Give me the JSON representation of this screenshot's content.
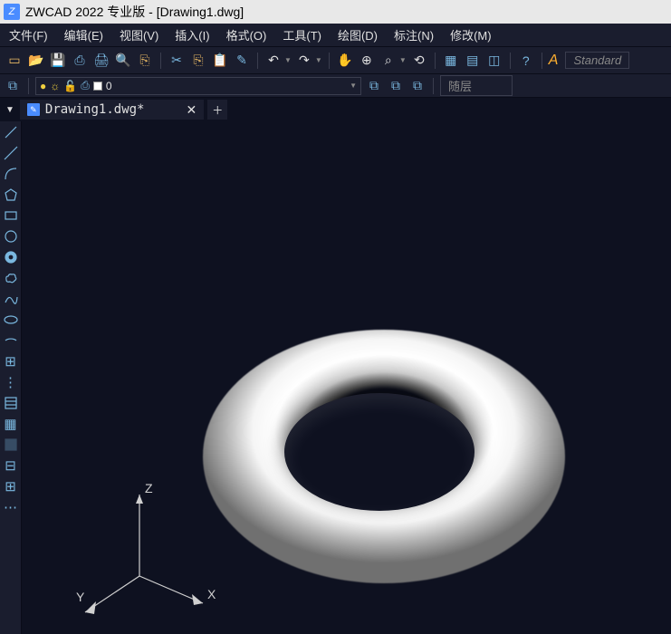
{
  "title": "ZWCAD 2022 专业版 - [Drawing1.dwg]",
  "menu": {
    "file": "文件(F)",
    "edit": "编辑(E)",
    "view": "视图(V)",
    "insert": "插入(I)",
    "format": "格式(O)",
    "tools": "工具(T)",
    "draw": "绘图(D)",
    "dim": "标注(N)",
    "modify": "修改(M)"
  },
  "style_box": "Standard",
  "layer": {
    "name": "0",
    "bylayer": "随层"
  },
  "tab": {
    "name": "Drawing1.dwg*"
  },
  "axes": {
    "x": "X",
    "y": "Y",
    "z": "Z"
  }
}
